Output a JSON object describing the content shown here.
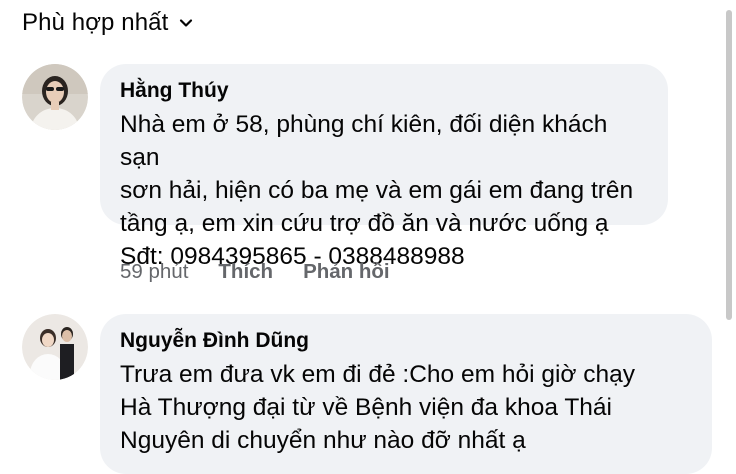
{
  "sort": {
    "label": "Phù hợp nhất",
    "icon": "chevron-down-icon"
  },
  "comments": [
    {
      "author": "Hằng Thúy",
      "text": "Nhà em ở 58, phùng chí kiên, đối diện khách sạn\nsơn hải, hiện có ba mẹ và em gái em đang trên\ntầng ạ, em xin cứu trợ đồ ăn và nước uống ạ\nSđt: 0984395865 - 0388488988",
      "time": "59 phút",
      "like_label": "Thích",
      "reply_label": "Phản hồi"
    },
    {
      "author": "Nguyễn Đình Dũng",
      "text": "Trưa em đưa vk em đi đẻ :Cho em  hỏi giờ chạy\nHà Thượng đại từ về Bệnh viện đa khoa Thái\nNguyên di chuyển như nào đỡ nhất ạ"
    }
  ],
  "colors": {
    "bubble": "#f0f2f5",
    "meta_text": "#65676b",
    "primary_text": "#050505"
  }
}
